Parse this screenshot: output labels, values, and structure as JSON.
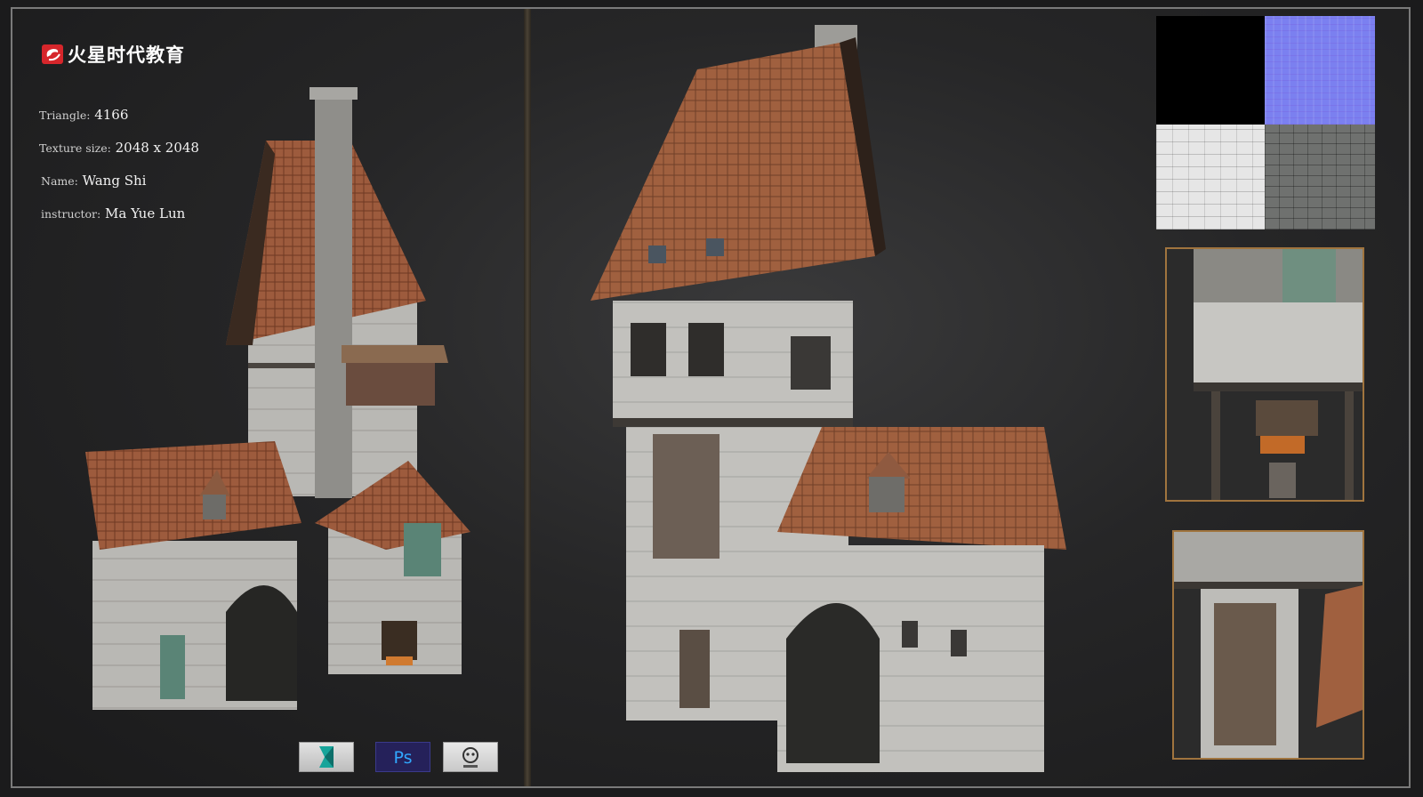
{
  "brand": {
    "logo_text": "火星时代教育",
    "accent_color": "#d6262b"
  },
  "info": [
    {
      "label": "Triangle:",
      "value": " 4166"
    },
    {
      "label": "Texture size:",
      "value": " 2048 x 2048"
    },
    {
      "label": "Name:",
      "value": " Wang Shi"
    },
    {
      "label": "instructor:",
      "value": " Ma Yue Lun"
    }
  ],
  "software_icons": [
    "3ds-max-icon",
    "photoshop-icon",
    "substance-painter-icon"
  ],
  "software_labels": {
    "photoshop": "Ps"
  },
  "colors": {
    "roof": "#9b5a3c",
    "wall": "#bdbcb8",
    "timber": "#4a4540",
    "frame_border": "#7a7a7a",
    "detail_border": "#a0743e",
    "normal_map": "#7b80f0"
  }
}
